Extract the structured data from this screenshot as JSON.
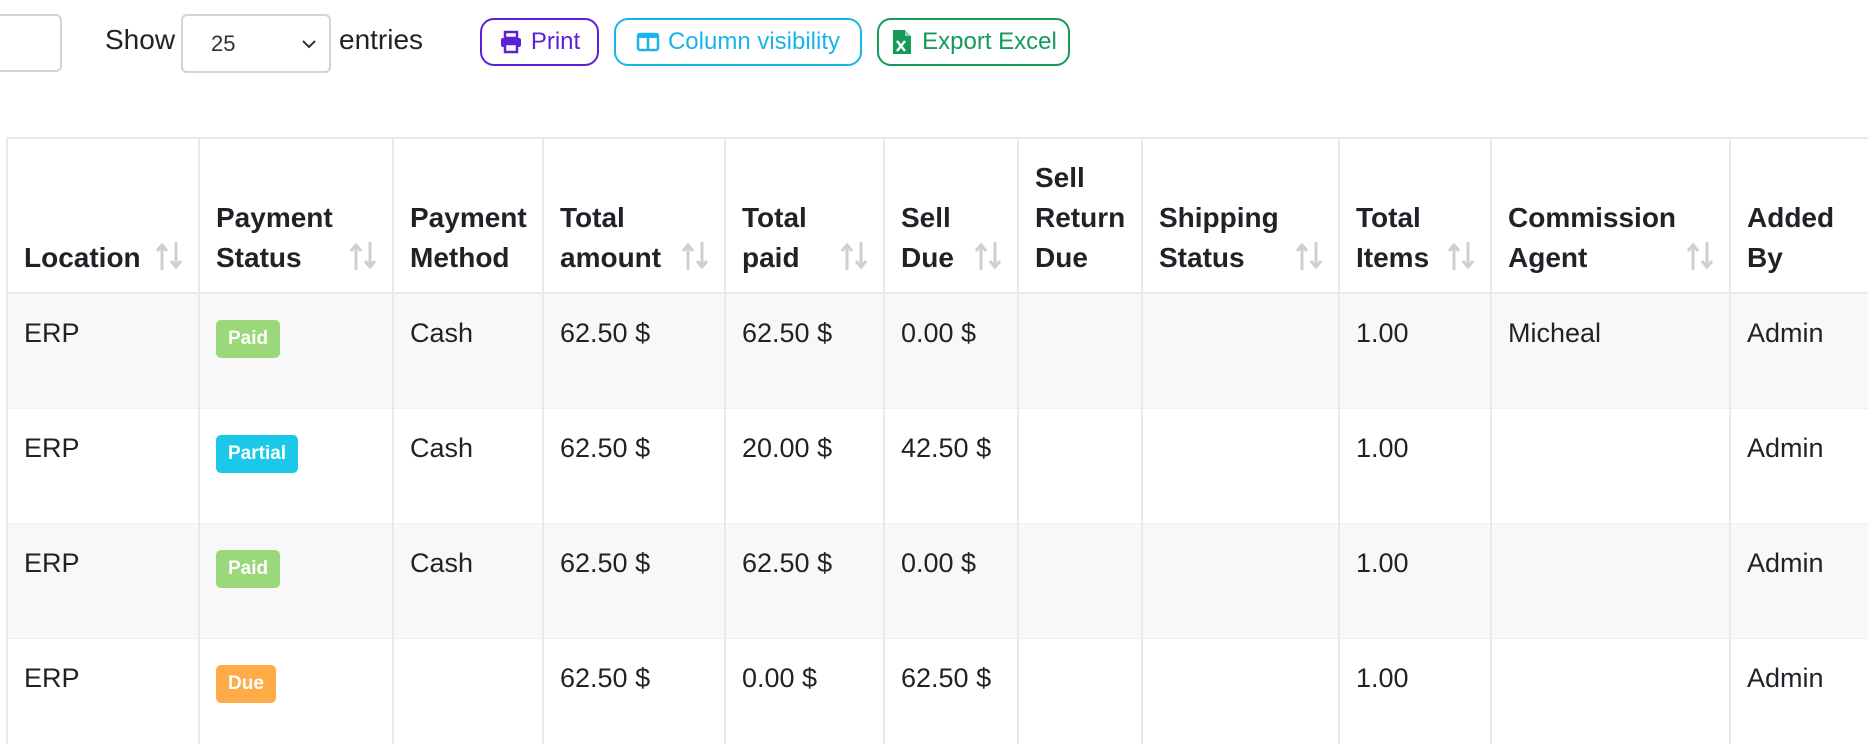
{
  "controls": {
    "show_label": "Show",
    "entries_value": "25",
    "entries_label": "entries",
    "buttons": {
      "print": "Print",
      "column_visibility": "Column visibility",
      "export_excel": "Export Excel"
    }
  },
  "colors": {
    "print": "#5b21d6",
    "column_visibility": "#1bb4e6",
    "export_excel": "#159a5a",
    "paid": "#9bd879",
    "partial": "#1cc8ea",
    "due": "#ffab47"
  },
  "table": {
    "columns": [
      "Location",
      "Payment Status",
      "Payment Method",
      "Total amount",
      "Total paid",
      "Sell Due",
      "Sell Return Due",
      "Shipping Status",
      "Total Items",
      "Commission Agent",
      "Added By"
    ],
    "rows": [
      {
        "location": "ERP",
        "payment_status": "Paid",
        "payment_method": "Cash",
        "total_amount": "62.50 $",
        "total_paid": "62.50 $",
        "sell_due": "0.00 $",
        "sell_return_due": "",
        "shipping_status": "",
        "total_items": "1.00",
        "commission_agent": "Micheal",
        "added_by": "Admin"
      },
      {
        "location": "ERP",
        "payment_status": "Partial",
        "payment_method": "Cash",
        "total_amount": "62.50 $",
        "total_paid": "20.00 $",
        "sell_due": "42.50 $",
        "sell_return_due": "",
        "shipping_status": "",
        "total_items": "1.00",
        "commission_agent": "",
        "added_by": "Admin"
      },
      {
        "location": "ERP",
        "payment_status": "Paid",
        "payment_method": "Cash",
        "total_amount": "62.50 $",
        "total_paid": "62.50 $",
        "sell_due": "0.00 $",
        "sell_return_due": "",
        "shipping_status": "",
        "total_items": "1.00",
        "commission_agent": "",
        "added_by": "Admin"
      },
      {
        "location": "ERP",
        "payment_status": "Due",
        "payment_method": "",
        "total_amount": "62.50 $",
        "total_paid": "0.00 $",
        "sell_due": "62.50 $",
        "sell_return_due": "",
        "shipping_status": "",
        "total_items": "1.00",
        "commission_agent": "",
        "added_by": "Admin"
      }
    ]
  }
}
